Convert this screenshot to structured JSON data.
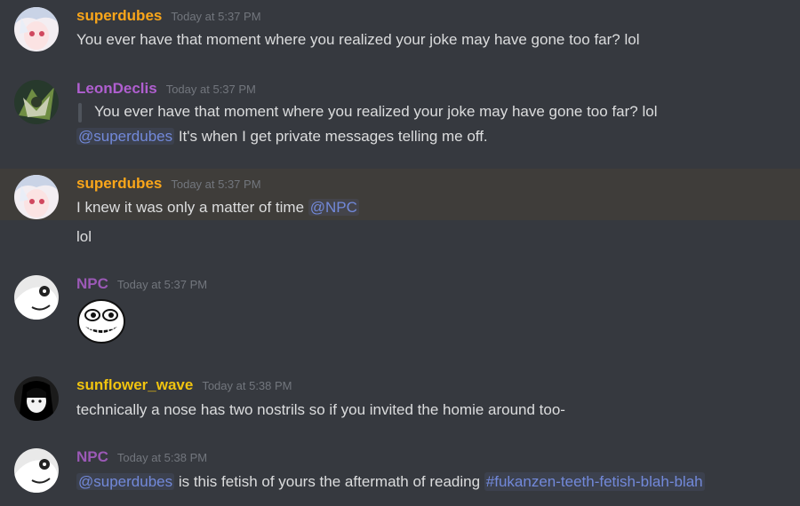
{
  "colors": {
    "background": "#36393f",
    "highlight": "#3f3d3a",
    "mention": "#7289da",
    "user_superdubes": "#faa61a",
    "user_leondeclis": "#b05fd0",
    "user_npc": "#9b59b6",
    "user_sunflower": "#f1c40f"
  },
  "messages": [
    {
      "author": "superdubes",
      "timestamp": "Today at 5:37 PM",
      "text": "You ever have that moment where you realized your joke may have gone too far? lol"
    },
    {
      "author": "LeonDeclis",
      "timestamp": "Today at 5:37 PM",
      "quote": "You ever have that moment where you realized your joke may have gone too far? lol",
      "mention": "@superdubes",
      "text": " It's when I get private messages telling me off."
    },
    {
      "author": "superdubes",
      "timestamp": "Today at 5:37 PM",
      "text": "I knew it was only a matter of time ",
      "mention": "@NPC",
      "text2": "lol"
    },
    {
      "author": "NPC",
      "timestamp": "Today at 5:37 PM",
      "emote": "trollface-emote"
    },
    {
      "author": "sunflower_wave",
      "timestamp": "Today at 5:38 PM",
      "text": "technically a nose has two nostrils so if you invited the homie around too-"
    },
    {
      "author": "NPC",
      "timestamp": "Today at 5:38 PM",
      "mention": "@superdubes",
      "text": " is this fetish of yours the aftermath of reading ",
      "channel": "#fukanzen-teeth-fetish-blah-blah"
    }
  ]
}
